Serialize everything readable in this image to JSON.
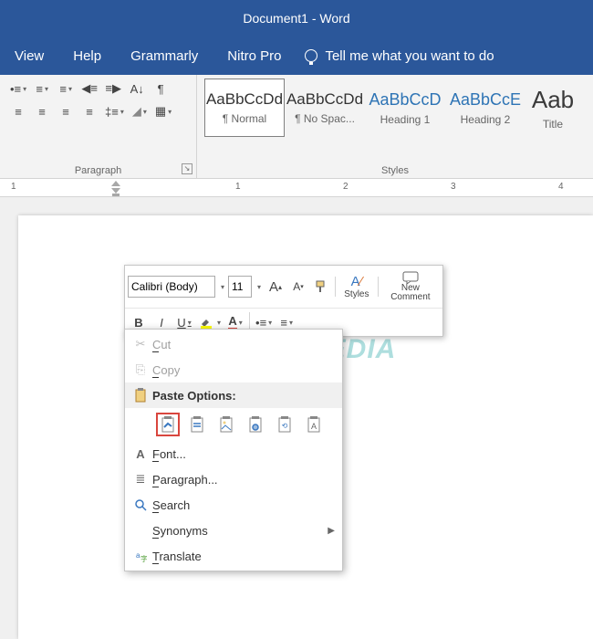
{
  "title": "Document1  -  Word",
  "menu": {
    "view": "View",
    "help": "Help",
    "grammarly": "Grammarly",
    "nitro": "Nitro Pro",
    "tellme": "Tell me what you want to do"
  },
  "ribbon": {
    "paragraph_label": "Paragraph",
    "styles_label": "Styles",
    "styles": [
      {
        "preview": "AaBbCcDd",
        "name": "¶ Normal"
      },
      {
        "preview": "AaBbCcDd",
        "name": "¶ No Spac..."
      },
      {
        "preview": "AaBbCcD",
        "name": "Heading 1"
      },
      {
        "preview": "AaBbCcE",
        "name": "Heading 2"
      },
      {
        "preview": "Aab",
        "name": "Title"
      }
    ]
  },
  "ruler": {
    "ticks": [
      "1",
      "1",
      "2",
      "3",
      "4"
    ]
  },
  "mini": {
    "font": "Calibri (Body)",
    "size": "11",
    "styles_label": "Styles",
    "newcomment": "New Comment",
    "bold": "B",
    "italic": "I",
    "underline": "U"
  },
  "ctx": {
    "cut": "Cut",
    "copy": "Copy",
    "paste_hdr": "Paste Options:",
    "font": "Font...",
    "paragraph": "Paragraph...",
    "search": "Search",
    "synonyms": "Synonyms",
    "translate": "Translate"
  },
  "watermark": "NESABAMEDIA"
}
